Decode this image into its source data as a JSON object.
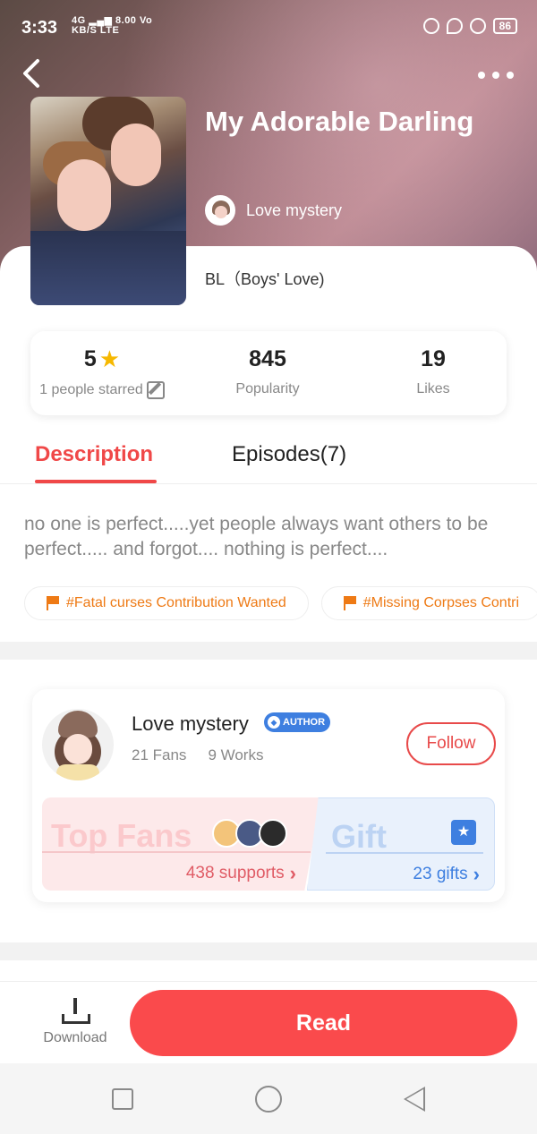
{
  "status_bar": {
    "time": "3:33",
    "network": "4G",
    "speed_value": "8.00",
    "speed_unit": "KB/S",
    "vo": "Vo",
    "lte": "LTE",
    "battery": "86"
  },
  "comic": {
    "title": "My Adorable Darling",
    "author": "Love mystery",
    "genre": "BL（Boys' Love)"
  },
  "stats": {
    "rating": "5",
    "rating_label": "1 people starred",
    "popularity": "845",
    "popularity_label": "Popularity",
    "likes": "19",
    "likes_label": "Likes"
  },
  "tabs": {
    "description": "Description",
    "episodes": "Episodes(7)"
  },
  "description": "no one is perfect.....yet people always want others to be perfect..... and forgot.... nothing is perfect....",
  "tags": [
    "#Fatal curses Contribution Wanted",
    "#Missing Corpses Contri"
  ],
  "author_card": {
    "name": "Love mystery",
    "badge": "AUTHOR",
    "fans": "21 Fans",
    "works": "9 Works",
    "follow_label": "Follow",
    "top_fans_label": "Top Fans",
    "supports": "438 supports",
    "gift_label": "Gift",
    "gifts": "23 gifts"
  },
  "bottom": {
    "download_label": "Download",
    "read_label": "Read"
  },
  "colors": {
    "accent": "#f04848",
    "read_button": "#fa4a4c",
    "tag_orange": "#ee7a15",
    "gift_blue": "#3e7fe0",
    "star": "#f6b800"
  }
}
